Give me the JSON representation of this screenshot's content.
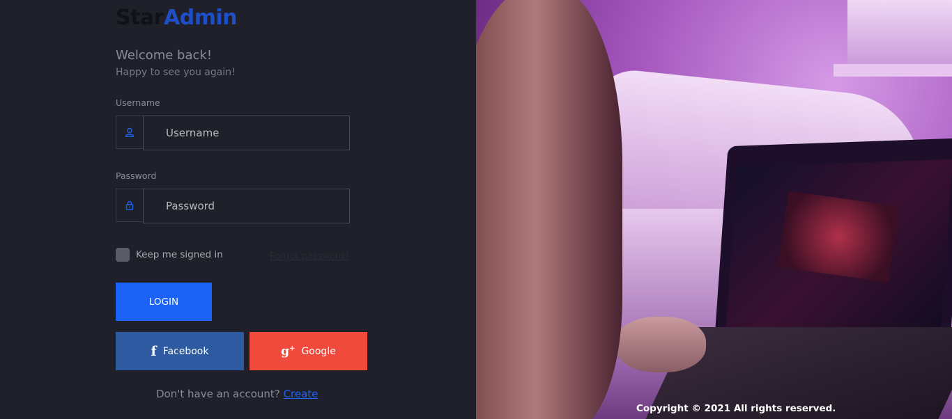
{
  "brand": {
    "part1": "Star",
    "part2": "Admin"
  },
  "header": {
    "welcome": "Welcome back!",
    "subtitle": "Happy to see you again!"
  },
  "form": {
    "username_label": "Username",
    "username_placeholder": "Username",
    "password_label": "Password",
    "password_placeholder": "Password",
    "keep_signed_in": "Keep me signed in",
    "forgot_password": "Forgot password?",
    "login": "LOGIN"
  },
  "social": {
    "facebook": "Facebook",
    "google": "Google"
  },
  "signup": {
    "text": "Don't have an account?",
    "link": "Create"
  },
  "footer": {
    "copyright": "Copyright © 2021 All rights reserved."
  },
  "colors": {
    "background": "#1f2029",
    "brand_accent": "#1f4fc7",
    "login_button": "#1b63f6",
    "facebook": "#2d5aa1",
    "google": "#ef4a3b"
  },
  "icons": {
    "username": "user-icon",
    "password": "lock-icon",
    "facebook": "facebook-icon",
    "google": "google-plus-icon"
  }
}
